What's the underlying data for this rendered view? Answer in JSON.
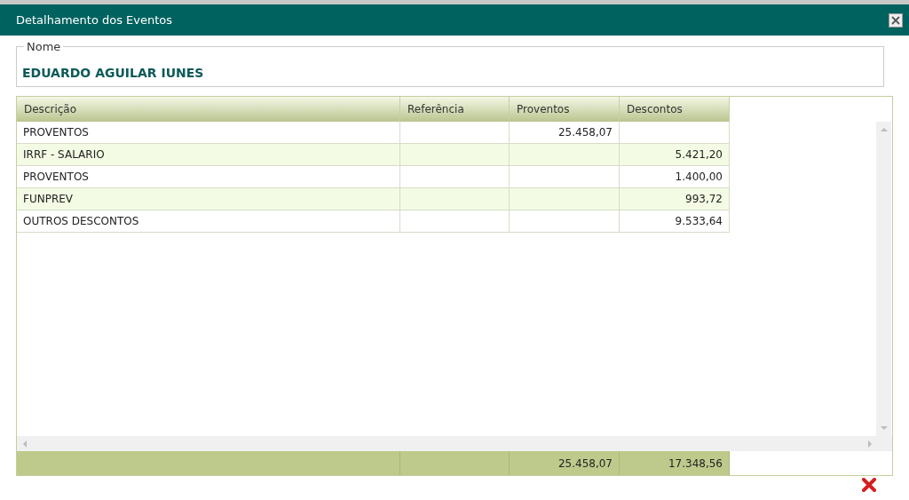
{
  "dialog": {
    "title": "Detalhamento dos Eventos"
  },
  "name_group": {
    "legend": "Nome",
    "value": "EDUARDO AGUILAR IUNES"
  },
  "table": {
    "columns": [
      "Descrição",
      "Referência",
      "Proventos",
      "Descontos"
    ],
    "rows": [
      {
        "description": "PROVENTOS",
        "earnings": "25.458,07"
      },
      {
        "description": "IRRF - SALARIO",
        "deductions": "5.421,20"
      },
      {
        "description": "PROVENTOS",
        "deductions": "1.400,00"
      },
      {
        "description": "FUNPREV",
        "deductions": "993,72"
      },
      {
        "description": "OUTROS DESCONTOS",
        "deductions": "9.533,64"
      }
    ],
    "totals": {
      "earnings": "25.458,07",
      "deductions": "17.348,56"
    }
  }
}
